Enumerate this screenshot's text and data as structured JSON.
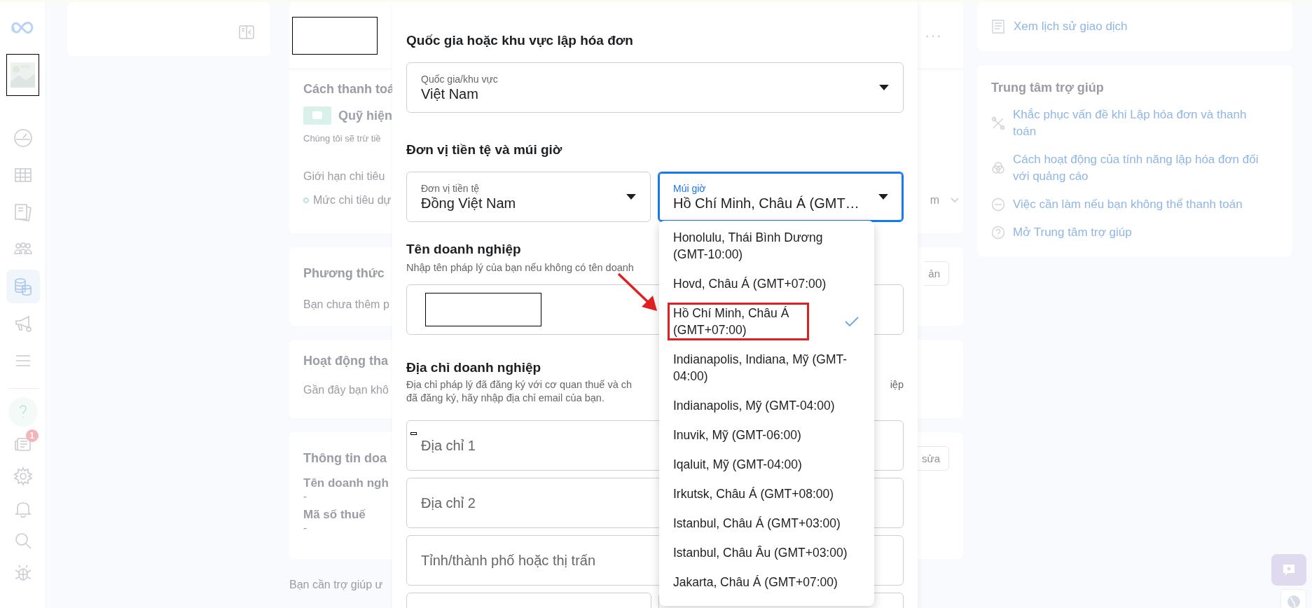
{
  "nav": {
    "items": [
      {
        "selected": false
      },
      {
        "selected": false
      },
      {
        "selected": false
      },
      {
        "selected": false
      },
      {
        "selected": true
      },
      {
        "selected": false
      },
      {
        "selected": false
      }
    ],
    "notification_badge": "1"
  },
  "more_button": "···",
  "payment_card": {
    "title": "Cách thanh toá",
    "fund": "Quỹ hiện",
    "note": "Chúng tôi sẽ trừ tiề",
    "limit_label": "Giới hạn chi tiêu",
    "limit_status": "Mức chi tiêu dự",
    "limit_tail": "m"
  },
  "methods_card": {
    "title": "Phương thức",
    "text": "Bạn chưa thêm p",
    "button": "ản"
  },
  "activity_card": {
    "title": "Hoạt động tha",
    "text": "Gần đây bạn khô"
  },
  "business_card": {
    "title": "Thông tin doa",
    "button": "sửa",
    "fields": [
      {
        "label": "Tên doanh ngh",
        "value": "-"
      },
      {
        "label": "Mã số thuế",
        "value": "-"
      }
    ]
  },
  "help_prompt": "Bạn cần trợ giúp ư",
  "history_link": "Xem lịch sử giao dịch",
  "help_center": {
    "title": "Trung tâm trợ giúp",
    "links": [
      "Khắc phục vấn đề khi Lập hóa đơn và thanh toán",
      "Cách hoạt động của tính năng lập hóa đơn đối với quảng cáo",
      "Việc cần làm nếu bạn không thể thanh toán",
      "Mở Trung tâm trợ giúp"
    ]
  },
  "modal": {
    "country_heading": "Quốc gia hoặc khu vực lập hóa đơn",
    "country_select": {
      "label": "Quốc gia/khu vực",
      "value": "Việt Nam"
    },
    "currency_heading": "Đơn vị tiền tệ và múi giờ",
    "currency_select": {
      "label": "Đơn vị tiền tệ",
      "value": "Đồng Việt Nam"
    },
    "timezone_select": {
      "label": "Múi giờ",
      "value": "Hồ Chí Minh, Châu Á (GMT…",
      "focused": true
    },
    "business_name": {
      "heading": "Tên doanh nghiệp",
      "hint": "Nhập tên pháp lý của bạn nếu không có tên doanh"
    },
    "address": {
      "heading": "Địa chỉ doanh nghiệp",
      "hint_start": "Địa chỉ pháp lý đã đăng ký với cơ quan thuế và ch",
      "hint_end": "iệp",
      "hint_line2": "đã đăng ký, hãy nhập địa chỉ email của bạn.",
      "fields": [
        {
          "placeholder": "Địa chỉ 1"
        },
        {
          "placeholder": "Địa chỉ 2"
        },
        {
          "placeholder": "Tỉnh/thành phố hoặc thị trấn"
        }
      ]
    }
  },
  "timezone_options": [
    {
      "label": "Honolulu, Thái Bình Dương (GMT-10:00)",
      "selected": false,
      "highlighted": false
    },
    {
      "label": "Hovd, Châu Á (GMT+07:00)",
      "selected": false,
      "highlighted": false
    },
    {
      "label": "Hồ Chí Minh, Châu Á (GMT+07:00)",
      "selected": true,
      "highlighted": true
    },
    {
      "label": "Indianapolis, Indiana, Mỹ (GMT-04:00)",
      "selected": false,
      "highlighted": false
    },
    {
      "label": "Indianapolis, Mỹ (GMT-04:00)",
      "selected": false,
      "highlighted": false
    },
    {
      "label": "Inuvik, Mỹ (GMT-06:00)",
      "selected": false,
      "highlighted": false
    },
    {
      "label": "Iqaluit, Mỹ (GMT-04:00)",
      "selected": false,
      "highlighted": false
    },
    {
      "label": "Irkutsk, Châu Á (GMT+08:00)",
      "selected": false,
      "highlighted": false
    },
    {
      "label": "Istanbul, Châu Á (GMT+03:00)",
      "selected": false,
      "highlighted": false
    },
    {
      "label": "Istanbul, Châu Âu (GMT+03:00)",
      "selected": false,
      "highlighted": false
    },
    {
      "label": "Jakarta, Châu Á (GMT+07:00)",
      "selected": false,
      "highlighted": false
    }
  ]
}
